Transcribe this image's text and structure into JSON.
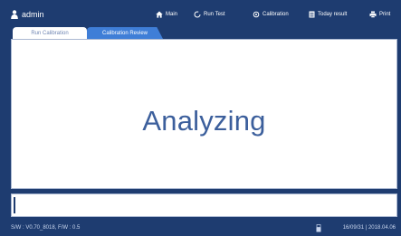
{
  "user": {
    "name": "admin",
    "icon": "user-icon"
  },
  "nav": {
    "main_label": "Main",
    "run_test_label": "Run Test",
    "calibration_label": "Calibration",
    "today_result_label": "Today result",
    "print_label": "Print",
    "icons": [
      "home-icon",
      "refresh-icon",
      "settings-icon",
      "document-icon",
      "print-icon"
    ]
  },
  "tabs": [
    {
      "label": "Run Calibration",
      "active": true
    },
    {
      "label": "Calibration Review",
      "active": false
    }
  ],
  "main": {
    "status_text": "Analyzing"
  },
  "progress": {
    "fraction": 0.005
  },
  "footer": {
    "version_text": "S/W : V0.70_8018, F/W : 0.5",
    "datetime_text": "16/09/31 | 2018.04.06",
    "icon": "usb-icon"
  },
  "colors": {
    "background": "#1e3c70",
    "panel": "#ffffff",
    "accent_text": "#3c5f9c",
    "inactive_tab": "#3f7ed7"
  }
}
